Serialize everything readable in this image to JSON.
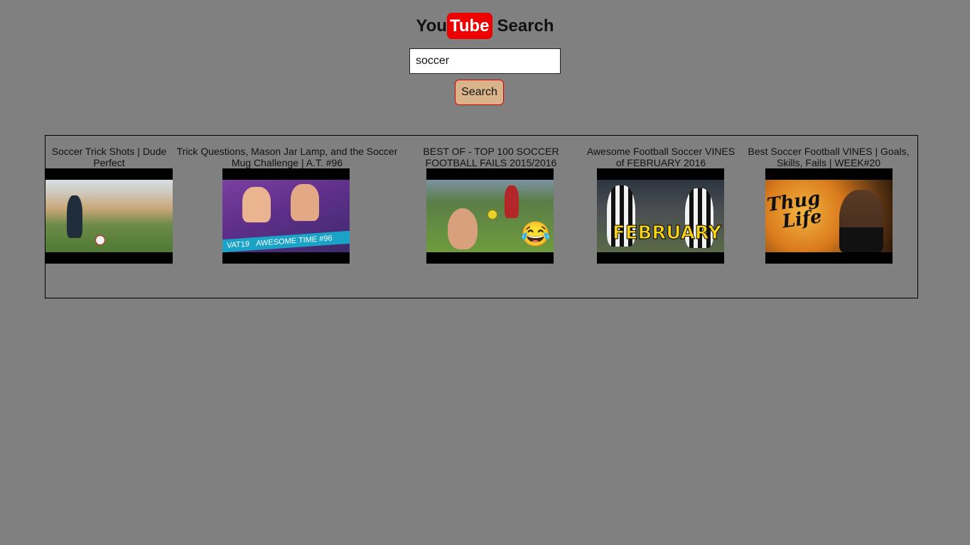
{
  "header": {
    "logo_you": "You",
    "logo_tube": "Tube",
    "logo_search": "Search"
  },
  "search": {
    "value": "soccer",
    "button_label": "Search"
  },
  "colors": {
    "page_background": "#808080",
    "logo_accent": "#ee0000",
    "button_background": "#d9b48a",
    "button_border": "#e00000"
  },
  "results": [
    {
      "title": "Soccer Trick Shots | Dude Perfect",
      "thumbnail": "soccer-trick-shots-thumbnail"
    },
    {
      "title": "Trick Questions, Mason Jar Lamp, and the Soccer Mug Challenge | A.T. #96",
      "thumbnail": "vat19-awesome-time-thumbnail",
      "thumbnail_text": [
        "VAT19",
        "AWESOME TIME #96"
      ]
    },
    {
      "title": "BEST OF - TOP 100 SOCCER FOOTBALL FAILS 2015/2016",
      "thumbnail": "soccer-fails-thumbnail",
      "thumbnail_emoji": "😂"
    },
    {
      "title": "Awesome Football Soccer VINES of FEBRUARY 2016",
      "thumbnail": "football-vines-february-thumbnail",
      "thumbnail_text": "FEBRUARY"
    },
    {
      "title": "Best Soccer Football VINES | Goals, Skills, Fails | WEEK#20",
      "thumbnail": "thug-life-thumbnail",
      "thumbnail_text": [
        "Thug",
        "Life"
      ]
    }
  ]
}
